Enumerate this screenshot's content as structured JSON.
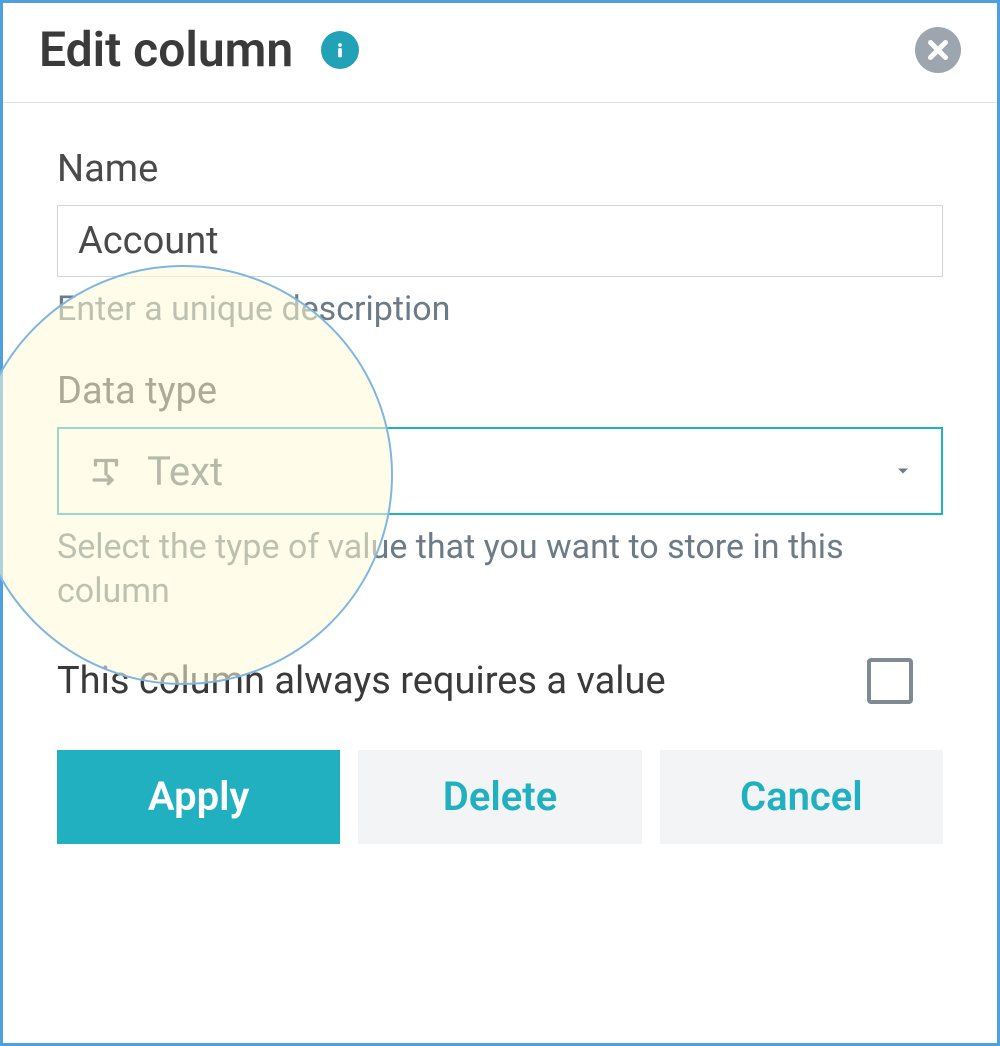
{
  "dialog": {
    "title": "Edit column"
  },
  "form": {
    "name_label": "Name",
    "name_value": "Account",
    "name_hint": "Enter a unique description",
    "datatype_label": "Data type",
    "datatype_value": "Text",
    "datatype_hint": "Select the type of value that you want to store in this column",
    "required_label": "This column always requires a value",
    "required_checked": false
  },
  "buttons": {
    "apply": "Apply",
    "delete": "Delete",
    "cancel": "Cancel"
  },
  "colors": {
    "accent": "#20b0c0",
    "border": "#4fa0e0",
    "muted": "#6c7b85"
  }
}
